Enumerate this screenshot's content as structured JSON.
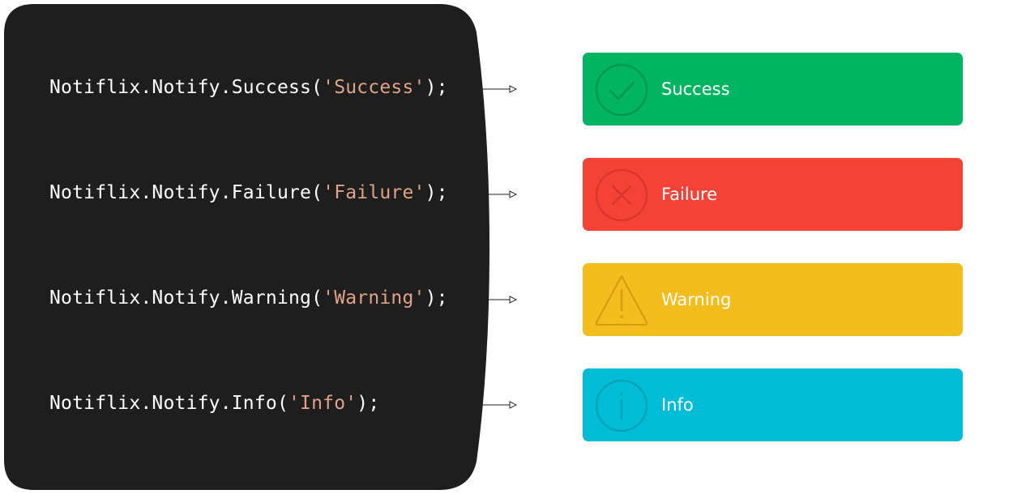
{
  "colors": {
    "code_background": "#1e1e1e",
    "code_text": "#ffffff",
    "code_string": "#e0a387",
    "success": "#00b462",
    "failure": "#f44336",
    "warning": "#f2bd1d",
    "info": "#00bcd4"
  },
  "code": {
    "lines": [
      {
        "prefix": "Notiflix.Notify.Success(",
        "arg": "'Success'",
        "suffix": ");"
      },
      {
        "prefix": "Notiflix.Notify.Failure(",
        "arg": "'Failure'",
        "suffix": ");"
      },
      {
        "prefix": "Notiflix.Notify.Warning(",
        "arg": "'Warning'",
        "suffix": ");"
      },
      {
        "prefix": "Notiflix.Notify.Info(",
        "arg": "'Info'",
        "suffix": ");"
      }
    ]
  },
  "notifications": [
    {
      "type": "success",
      "label": "Success",
      "icon": "check-circle-icon"
    },
    {
      "type": "failure",
      "label": "Failure",
      "icon": "x-circle-icon"
    },
    {
      "type": "warning",
      "label": "Warning",
      "icon": "warning-triangle-icon"
    },
    {
      "type": "info",
      "label": "Info",
      "icon": "info-circle-icon"
    }
  ]
}
